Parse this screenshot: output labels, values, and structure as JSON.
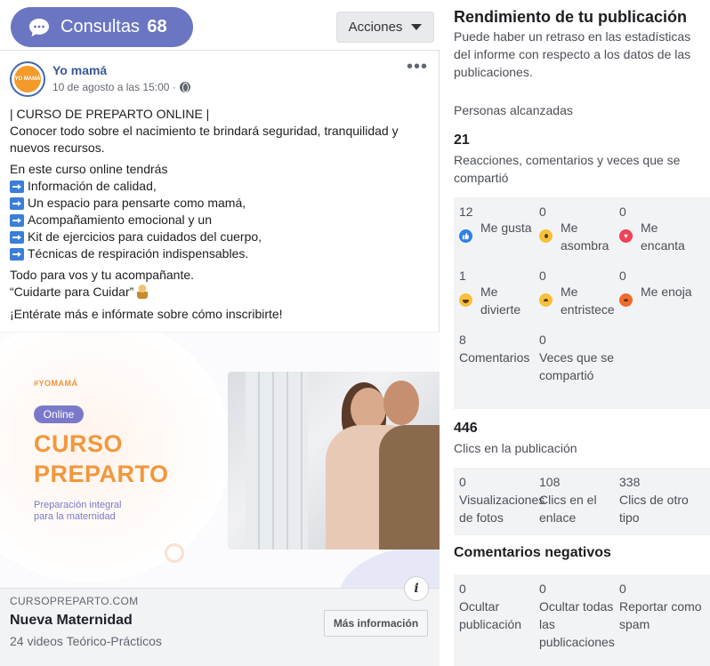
{
  "top": {
    "consultas_label": "Consultas",
    "consultas_count": "68",
    "acciones_label": "Acciones"
  },
  "post": {
    "page_name": "Yo mamá",
    "avatar_text": "YO MAMÁ",
    "meta": "10 de agosto a las 15:00 ·",
    "text": {
      "line1": "| CURSO DE PREPARTO ONLINE |",
      "line2": "Conocer todo sobre el nacimiento te brindará seguridad, tranquilidad y nuevos recursos.",
      "intro": "En este curso online tendrás",
      "bullets": [
        "Información de calidad,",
        "Un espacio para pensarte como mamá,",
        "Acompañamiento emocional y un",
        "Kit de ejercicios para cuidados del cuerpo,",
        "Técnicas de respiración indispensables."
      ],
      "closing1": "Todo para vos y tu acompañante.",
      "closing2": "“Cuidarte para Cuidar”",
      "cta": "¡Entérate más e infórmate sobre cómo inscribirte!"
    },
    "image": {
      "hashtag": "#YOMAMÁ",
      "pill": "Online",
      "title_line1": "CURSO",
      "title_line2": "PREPARTO",
      "subtitle_line1": "Preparación integral",
      "subtitle_line2": "para la maternidad"
    },
    "link": {
      "domain": "CURSOPREPARTO.COM",
      "title": "Nueva Maternidad",
      "description": "24 videos Teórico-Prácticos",
      "button": "Más información"
    }
  },
  "panel": {
    "title": "Rendimiento de tu publicación",
    "subtitle": "Puede haber un retraso en las estadísticas del informe con respecto a los datos de las publicaciones.",
    "reach_label": "Personas alcanzadas",
    "reach_value": "21",
    "engagement_label": "Reacciones, comentarios y veces que se compartió",
    "reactions": [
      {
        "count": "12",
        "label": "Me gusta"
      },
      {
        "count": "0",
        "label": "Me asombra"
      },
      {
        "count": "0",
        "label": "Me encanta"
      },
      {
        "count": "1",
        "label": "Me divierte"
      },
      {
        "count": "0",
        "label": "Me entristece"
      },
      {
        "count": "0",
        "label": "Me enoja"
      }
    ],
    "comments": {
      "count": "8",
      "label": "Comentarios"
    },
    "shares": {
      "count": "0",
      "label": "Veces que se compartió"
    },
    "clicks_value": "446",
    "clicks_label": "Clics en la publicación",
    "click_breakdown": [
      {
        "count": "0",
        "label": "Visualizaciones de fotos"
      },
      {
        "count": "108",
        "label": "Clics en el enlace"
      },
      {
        "count": "338",
        "label": "Clics de otro tipo"
      }
    ],
    "negative_title": "Comentarios negativos",
    "negative": [
      {
        "count": "0",
        "label": "Ocultar publicación"
      },
      {
        "count": "0",
        "label": "Ocultar todas las publicaciones"
      },
      {
        "count": "0",
        "label": "Reportar como spam"
      }
    ]
  }
}
